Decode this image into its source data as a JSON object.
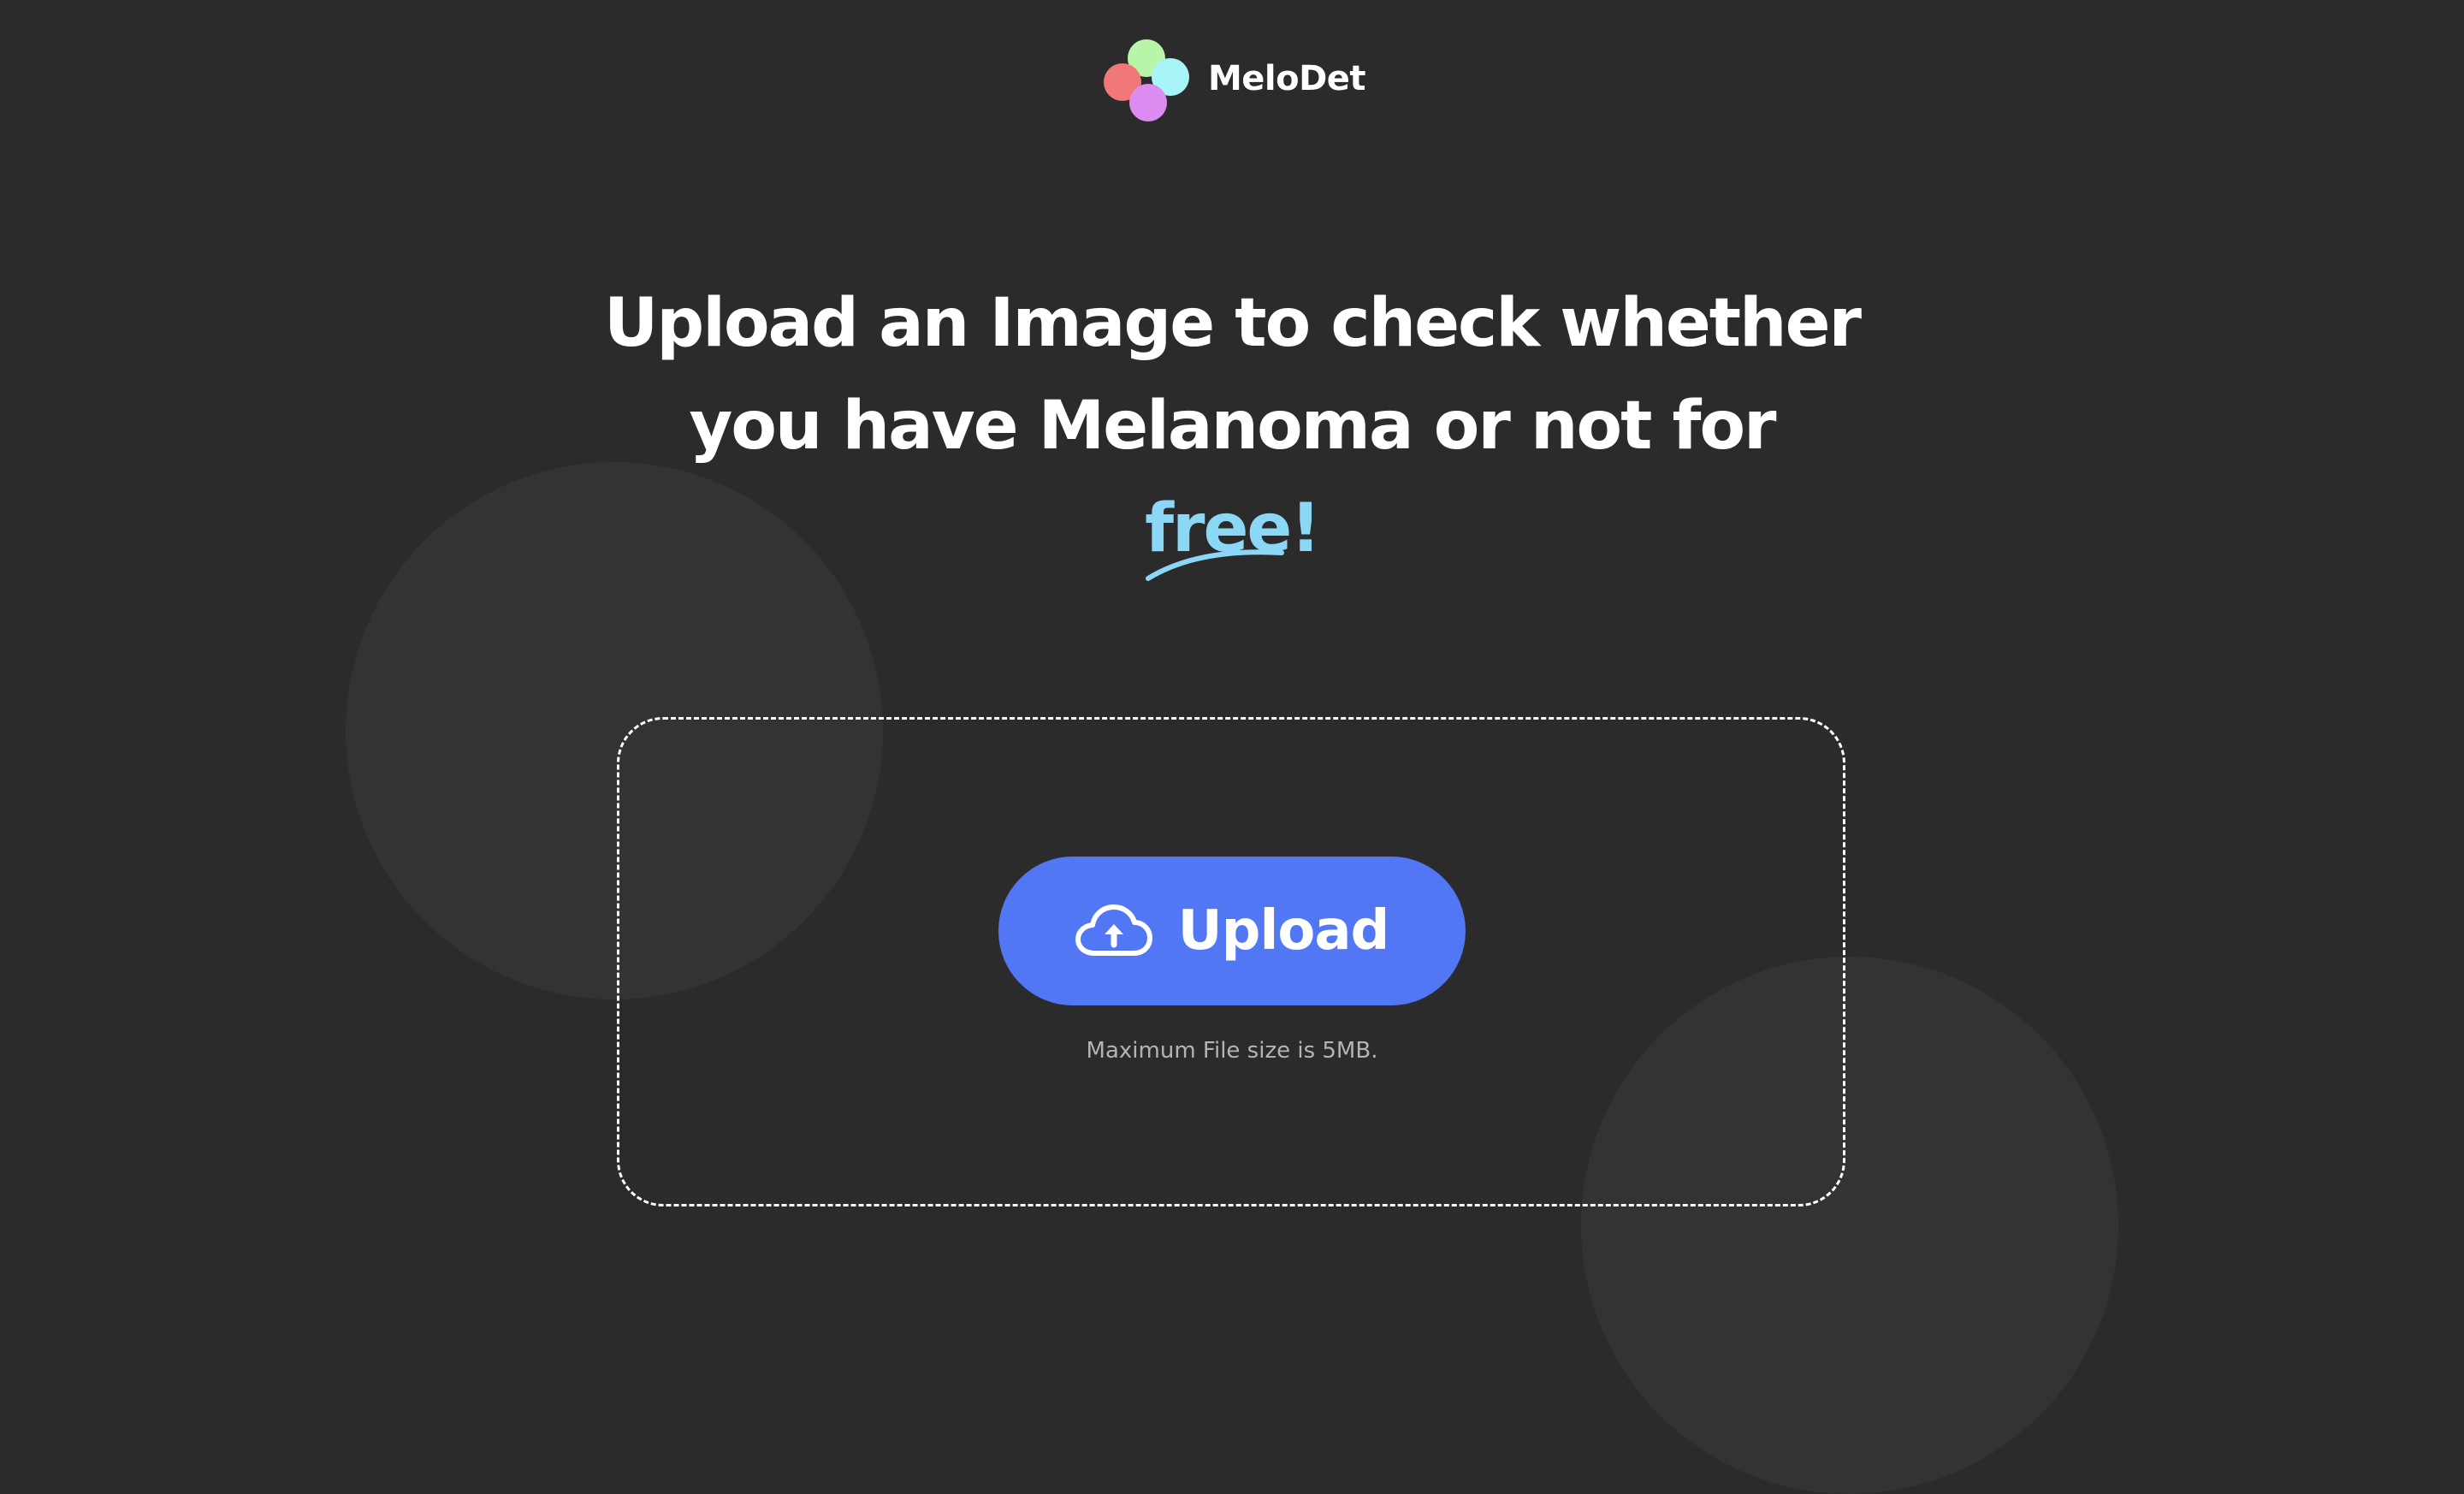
{
  "brand": {
    "name": "MeloDet",
    "logo_colors": [
      "#b8f5a8",
      "#f07878",
      "#a8f5f8",
      "#dc8cf0"
    ]
  },
  "headline": {
    "line1": "Upload an Image to check whether",
    "line2": "you have Melanoma or not for",
    "highlight": "free",
    "punctuation": "!",
    "highlight_color": "#8ad8f5"
  },
  "upload": {
    "button_label": "Upload",
    "button_icon": "cloud-upload-icon",
    "button_color": "#5277f5",
    "hint": "Maximum File size is 5MB."
  },
  "theme": {
    "background": "#2b2b2b",
    "accent_circle": "#333333"
  }
}
